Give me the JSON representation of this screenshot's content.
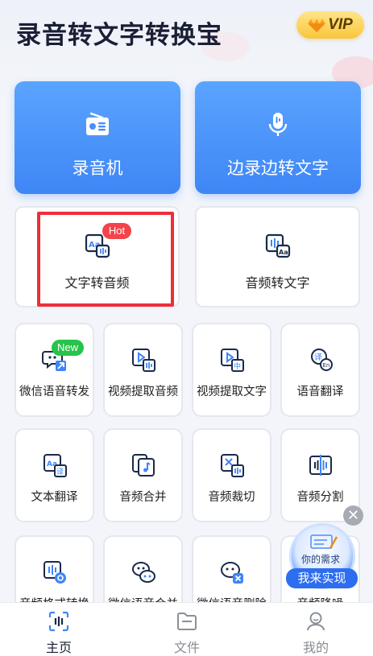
{
  "app": {
    "title": "录音转文字转换宝",
    "vip_label": "VIP"
  },
  "hero": [
    {
      "label": "录音机",
      "icon": "radio-icon"
    },
    {
      "label": "边录边转文字",
      "icon": "microphone-icon"
    }
  ],
  "features": [
    {
      "label": "文字转音频",
      "icon": "text-to-audio-icon",
      "badge": "Hot"
    },
    {
      "label": "音频转文字",
      "icon": "audio-to-text-icon"
    }
  ],
  "tools": [
    {
      "label": "微信语音转发",
      "icon": "wechat-forward-icon",
      "badge": "New"
    },
    {
      "label": "视频提取音频",
      "icon": "video-extract-audio-icon"
    },
    {
      "label": "视频提取文字",
      "icon": "video-extract-text-icon"
    },
    {
      "label": "语音翻译",
      "icon": "voice-translate-icon"
    },
    {
      "label": "文本翻译",
      "icon": "text-translate-icon"
    },
    {
      "label": "音频合并",
      "icon": "audio-merge-icon"
    },
    {
      "label": "音频裁切",
      "icon": "audio-cut-icon"
    },
    {
      "label": "音频分割",
      "icon": "audio-split-icon"
    },
    {
      "label": "音频格式转换",
      "icon": "audio-format-icon"
    },
    {
      "label": "微信语音合并",
      "icon": "wechat-merge-icon"
    },
    {
      "label": "微信语音删除",
      "icon": "wechat-delete-icon"
    },
    {
      "label": "音频降噪",
      "icon": "audio-denoise-icon"
    }
  ],
  "floating": {
    "line1": "你的需求",
    "button": "我来实现"
  },
  "tabbar": [
    {
      "label": "主页",
      "icon": "home-scan-icon",
      "active": true
    },
    {
      "label": "文件",
      "icon": "folder-icon",
      "active": false
    },
    {
      "label": "我的",
      "icon": "profile-icon",
      "active": false
    }
  ],
  "colors": {
    "accent": "#3f86f6",
    "hot": "#f2444a",
    "new": "#27c34a",
    "highlight": "#ec2f3a"
  }
}
